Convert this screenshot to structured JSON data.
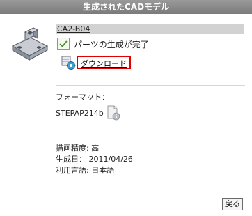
{
  "window": {
    "title": "生成されたCADモデル"
  },
  "part": {
    "name": "CA2-B04",
    "thumbnail_icon": "bracket-3d-model-icon"
  },
  "status": {
    "icon": "check-icon",
    "text": "パーツの生成が完了"
  },
  "download": {
    "icon": "download-cad-icon",
    "label": "ダウンロード",
    "highlight_color": "#e00000"
  },
  "format": {
    "label": "フォーマット：",
    "value": "STEPAP214b",
    "info_icon": "document-info-icon"
  },
  "details": {
    "precision": "描画精度: 高",
    "created": "生成日：  2011/04/26",
    "language": "利用言語: 日本語"
  },
  "footer": {
    "back_label": "戻る"
  }
}
